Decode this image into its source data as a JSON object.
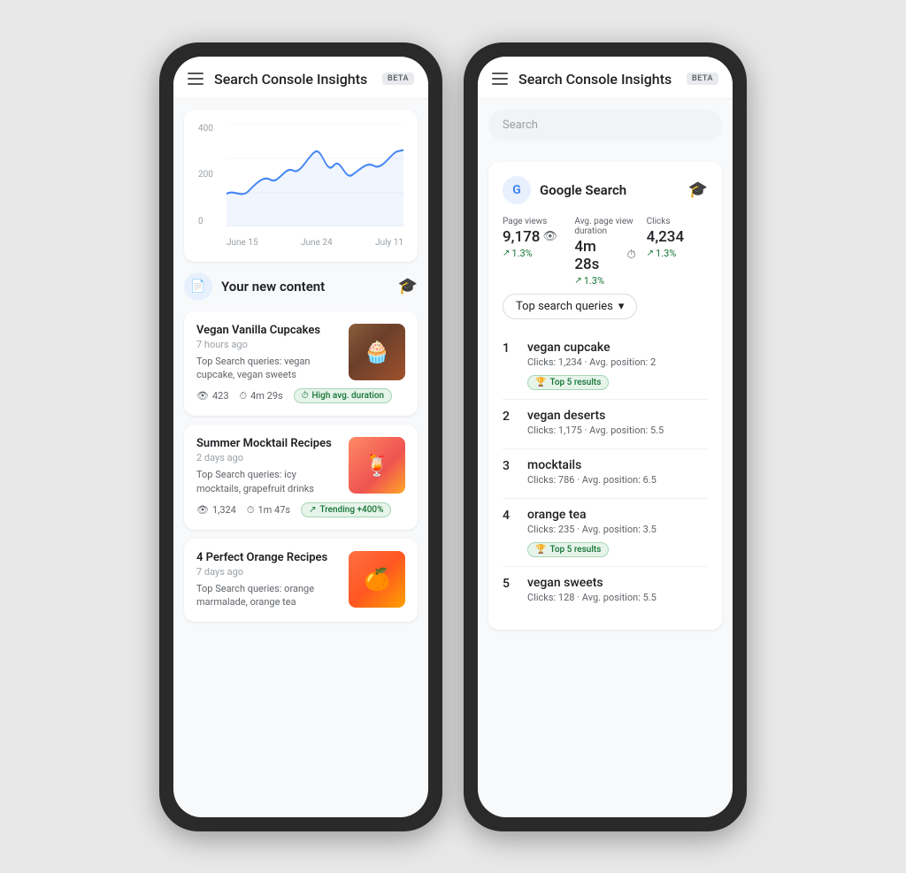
{
  "app": {
    "title": "Search Console Insights",
    "beta_label": "BETA"
  },
  "left_phone": {
    "chart": {
      "y_labels": [
        "400",
        "200",
        "0"
      ],
      "x_labels": [
        "June 15",
        "June 24",
        "July 11"
      ]
    },
    "new_content": {
      "section_title": "Your new content",
      "items": [
        {
          "title": "Vegan Vanilla Cupcakes",
          "time": "7 hours ago",
          "queries": "Top Search queries: vegan cupcake, vegan sweets",
          "views": "423",
          "duration": "4m 29s",
          "badge_text": "High avg. duration",
          "badge_type": "green",
          "thumb_emoji": "🧁"
        },
        {
          "title": "Summer Mocktail Recipes",
          "time": "2 days ago",
          "queries": "Top Search queries: icy mocktails, grapefruit drinks",
          "views": "1,324",
          "duration": "1m 47s",
          "badge_text": "Trending +400%",
          "badge_type": "teal",
          "thumb_emoji": "🍹"
        },
        {
          "title": "4 Perfect Orange Recipes",
          "time": "7 days ago",
          "queries": "Top Search queries: orange marmalade, orange tea",
          "views": "",
          "duration": "",
          "badge_text": "",
          "badge_type": "",
          "thumb_emoji": "🍊"
        }
      ]
    }
  },
  "right_phone": {
    "search_placeholder": "Search",
    "google_search": {
      "title": "Google Search",
      "metrics": [
        {
          "label": "Page views",
          "value": "9,178",
          "icon": "👁",
          "trend": "1.3%"
        },
        {
          "label": "Avg. page view duration",
          "value": "4m 28s",
          "icon": "⏱",
          "trend": "1.3%"
        },
        {
          "label": "Clicks",
          "value": "4,234",
          "icon": "",
          "trend": "1.3%"
        }
      ]
    },
    "top_queries": {
      "dropdown_label": "Top search queries",
      "items": [
        {
          "num": "1",
          "name": "vegan cupcake",
          "clicks": "1,234",
          "avg_position": "2",
          "badge": "Top 5 results"
        },
        {
          "num": "2",
          "name": "vegan deserts",
          "clicks": "1,175",
          "avg_position": "5.5",
          "badge": ""
        },
        {
          "num": "3",
          "name": "mocktails",
          "clicks": "786",
          "avg_position": "6.5",
          "badge": ""
        },
        {
          "num": "4",
          "name": "orange tea",
          "clicks": "235",
          "avg_position": "3.5",
          "badge": "Top 5 results"
        },
        {
          "num": "5",
          "name": "vegan sweets",
          "clicks": "128",
          "avg_position": "5.5",
          "badge": ""
        }
      ]
    }
  },
  "icons": {
    "hamburger": "≡",
    "help": "🎓",
    "eye": "👁",
    "clock": "⏱",
    "trending": "↗",
    "arrow_up": "↗",
    "trophy": "🏆",
    "chevron_down": "▾"
  }
}
